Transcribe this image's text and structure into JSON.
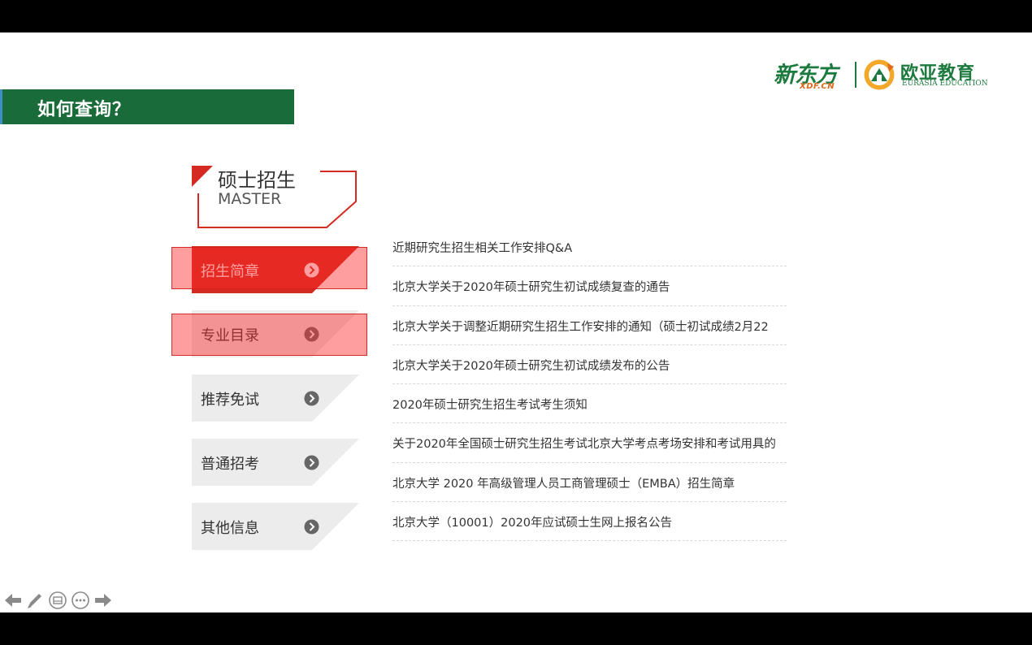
{
  "slide": {
    "title": "如何查询？"
  },
  "logos": {
    "xdf_main": "新东方",
    "xdf_sub": "XDF.CN",
    "eurasia_cn": "欧亚教育",
    "eurasia_en": "EURASIA EDUCATION",
    "eurasia_mark": "eurasia-logo-mark"
  },
  "section": {
    "title_cn": "硕士招生",
    "title_en": "MASTER"
  },
  "menu": [
    {
      "label": "招生简章",
      "active": true,
      "highlighted": true
    },
    {
      "label": "专业目录",
      "active": false,
      "highlighted": true
    },
    {
      "label": "推荐免试",
      "active": false,
      "highlighted": false
    },
    {
      "label": "普通招考",
      "active": false,
      "highlighted": false
    },
    {
      "label": "其他信息",
      "active": false,
      "highlighted": false
    }
  ],
  "news": [
    "近期研究生招生相关工作安排Q&A",
    "北京大学关于2020年硕士研究生初试成绩复查的通告",
    "北京大学关于调整近期研究生招生工作安排的通知（硕士初试成绩2月22",
    "北京大学关于2020年硕士研究生初试成绩发布的公告",
    "2020年硕士研究生招生考试考生须知",
    "关于2020年全国硕士研究生招生考试北京大学考点考场安排和考试用具的",
    "北京大学 2020 年高级管理人员工商管理硕士（EMBA）招生简章",
    "北京大学（10001）2020年应试硕士生网上报名公告"
  ],
  "toolbar": {
    "icons": [
      "arrow-left-icon",
      "pen-icon",
      "slides-icon",
      "more-icon",
      "arrow-right-icon"
    ]
  },
  "colors": {
    "title_banner": "#1a6b3a",
    "brand_green": "#1c7a3e",
    "brand_orange": "#e0691c",
    "accent_red": "#d42a22",
    "highlight": "rgba(255,40,40,0.45)"
  }
}
